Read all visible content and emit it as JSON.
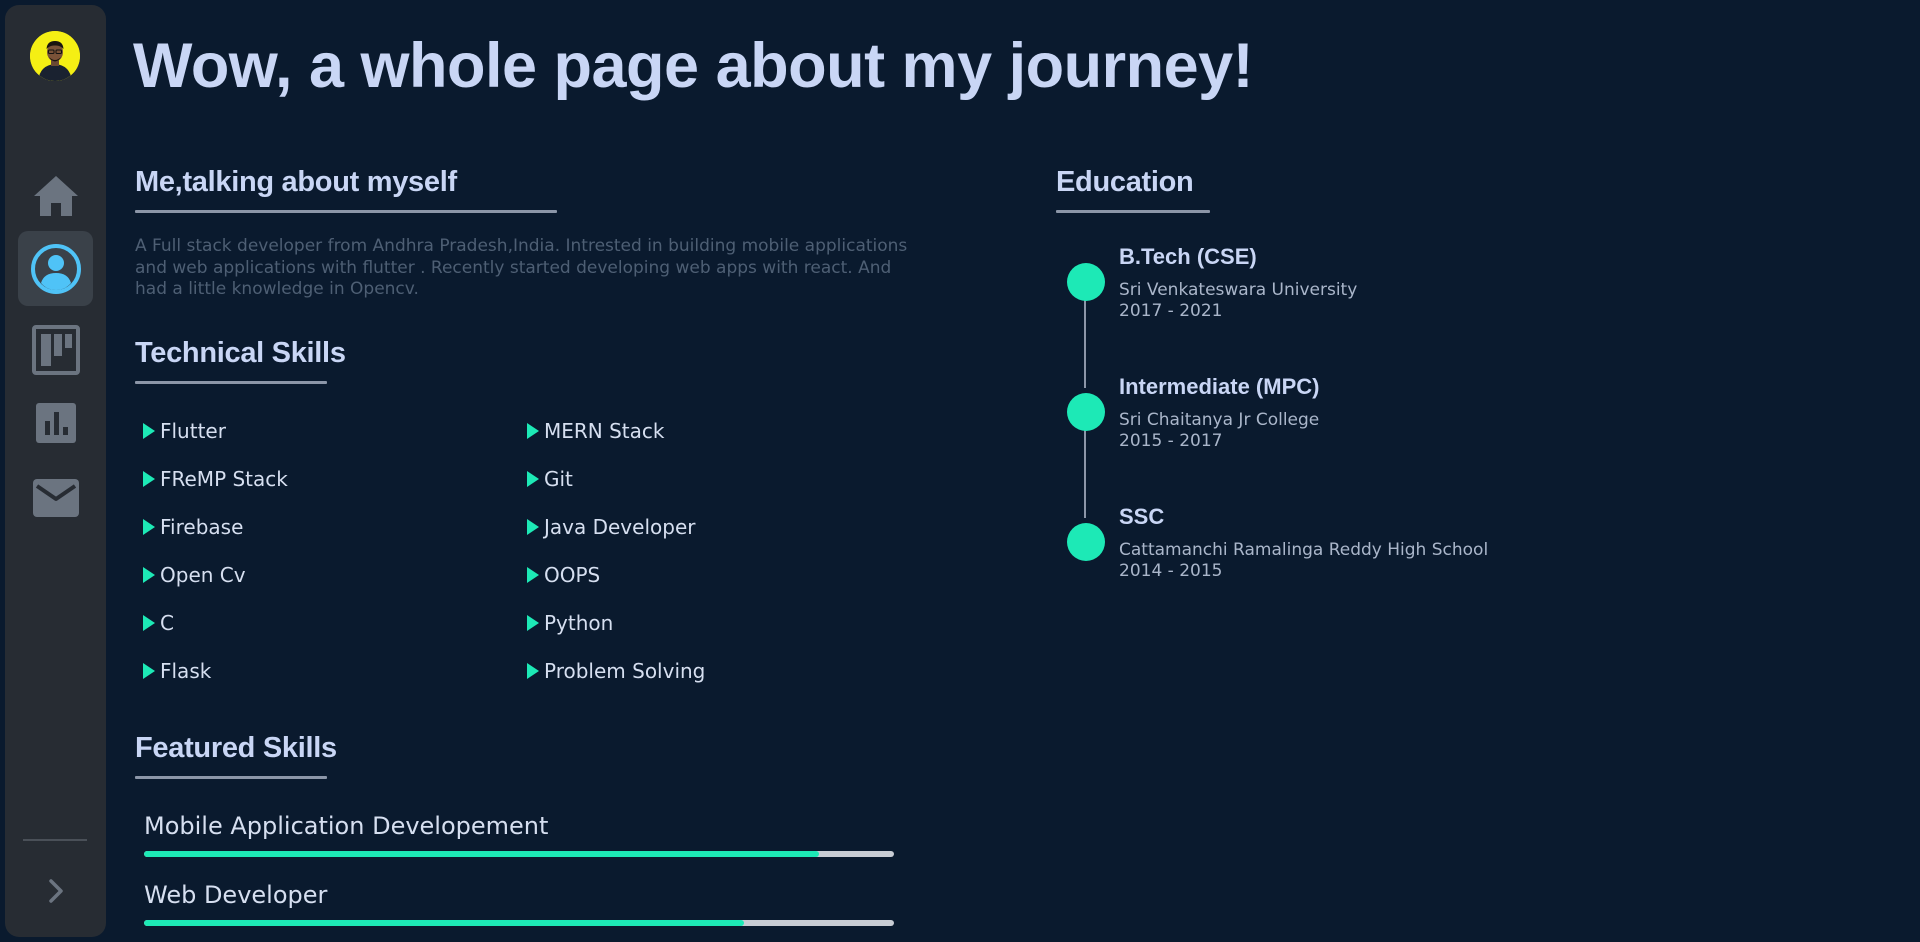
{
  "sidebar": {
    "avatar_alt": "profile photo",
    "items": [
      {
        "icon": "home-icon",
        "active": false
      },
      {
        "icon": "account-icon",
        "active": true
      },
      {
        "icon": "projects-board-icon",
        "active": false
      },
      {
        "icon": "bar-chart-icon",
        "active": false
      },
      {
        "icon": "mail-icon",
        "active": false
      }
    ],
    "expand_icon": "chevron-right-icon"
  },
  "page_title": "Wow, a whole page about my journey!",
  "about": {
    "heading": "Me,talking about myself",
    "text": "A Full stack developer from Andhra Pradesh,India. Intrested in building mobile applications and web applications with flutter . Recently started developing web apps with react. And had a little knowledge in Opencv."
  },
  "technical_skills": {
    "heading": "Technical Skills",
    "left": [
      "Flutter",
      "FReMP Stack",
      "Firebase",
      "Open Cv",
      "C",
      "Flask"
    ],
    "right": [
      "MERN Stack",
      "Git",
      "Java Developer",
      "OOPS",
      "Python",
      "Problem Solving"
    ]
  },
  "featured_skills": {
    "heading": "Featured Skills",
    "bars": [
      {
        "label": "Mobile Application Developement",
        "level": 0.9
      },
      {
        "label": "Web Developer",
        "level": 0.8
      }
    ]
  },
  "education": {
    "heading": "Education",
    "items": [
      {
        "title": "B.Tech (CSE)",
        "institution": "Sri Venkateswara University",
        "years": "2017 - 2021"
      },
      {
        "title": "Intermediate (MPC)",
        "institution": "Sri Chaitanya Jr College",
        "years": "2015 - 2017"
      },
      {
        "title": "SSC",
        "institution": "Cattamanchi Ramalinga Reddy High School",
        "years": "2014 - 2015"
      }
    ]
  },
  "colors": {
    "background": "#0a1a2e",
    "sidebar": "#272c33",
    "accent": "#1de9b6",
    "active_icon": "#4fc3f7",
    "inactive_icon": "#6b7480"
  }
}
